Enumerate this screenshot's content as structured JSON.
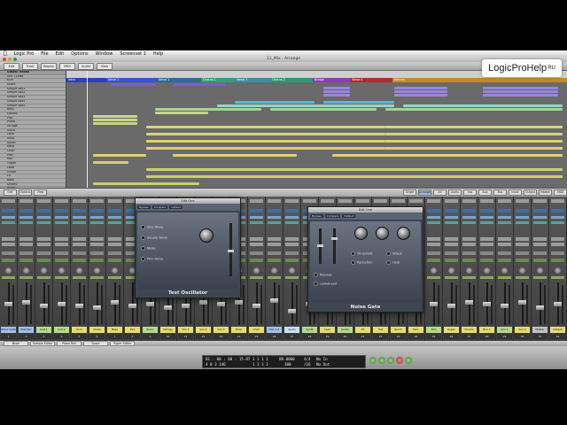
{
  "menubar": {
    "apple": "",
    "items": [
      "Logic Pro",
      "File",
      "Edit",
      "Options",
      "Window",
      "Screenset 1",
      "Help"
    ]
  },
  "window": {
    "title": "11_Mix - Arrange"
  },
  "toolbar": {
    "buttons": [
      "Edit",
      "Track",
      "Region",
      "MIDI",
      "Audio",
      "View"
    ]
  },
  "arrange": {
    "tracklist_header": "Global Tracks",
    "tracks": [
      "Inst 1 Lead",
      "Kick",
      "Snare",
      "Simple Vox1",
      "Simple Vox2",
      "Simple Vox3",
      "Simple Vox4",
      "Simple Vox5",
      "Bass",
      "Electric",
      "Pad",
      "Piano",
      "Strings",
      "Violin",
      "Cello",
      "Viola",
      "Synth",
      "Harp",
      "Choir",
      "Perc",
      "Hat",
      "Organ",
      "Lead",
      "Guitar",
      "FX",
      "Bass",
      "Drums",
      "Room",
      "Shaker",
      "Tom",
      "Vox"
    ],
    "markers": [
      {
        "label": "Intro",
        "color": "#2f3fbf"
      },
      {
        "label": "Verse 1",
        "color": "#3a52d1"
      },
      {
        "label": "Verse 2",
        "color": "#2f6a9a"
      },
      {
        "label": "Chorus 1",
        "color": "#2fa07a"
      },
      {
        "label": "Verse 3",
        "color": "#3a8fa6"
      },
      {
        "label": "Chorus 2",
        "color": "#2b9b6f"
      },
      {
        "label": "Bridge",
        "color": "#8a3fb0"
      },
      {
        "label": "Verse 4",
        "color": "#b02d2d"
      },
      {
        "label": "Refrain",
        "color": "#c48a2a"
      }
    ]
  },
  "mixer": {
    "tabs": [
      "Edit",
      "Options",
      "View",
      "Single",
      "Arrange",
      "All",
      "Audio",
      "Inst",
      "Aux",
      "Bus",
      "Input",
      "Output",
      "Master",
      "MIDI"
    ],
    "strips": [
      {
        "name": "Noise Gate",
        "num": "1"
      },
      {
        "name": "Test Osc",
        "num": "2"
      },
      {
        "name": "Inst 1",
        "num": "3"
      },
      {
        "name": "Inst 2",
        "num": "4"
      },
      {
        "name": "Kick",
        "num": "5"
      },
      {
        "name": "Snare",
        "num": "6"
      },
      {
        "name": "Bass",
        "num": "7"
      },
      {
        "name": "Pad",
        "num": "8"
      },
      {
        "name": "Piano",
        "num": "9"
      },
      {
        "name": "Strings",
        "num": "10"
      },
      {
        "name": "Vox 1",
        "num": "11"
      },
      {
        "name": "Vox 2",
        "num": "12"
      },
      {
        "name": "Vox 3",
        "num": "13"
      },
      {
        "name": "Harp",
        "num": "14"
      },
      {
        "name": "Choir",
        "num": "15"
      },
      {
        "name": "Out 1-2",
        "num": "16"
      },
      {
        "name": "Audio",
        "num": "17"
      },
      {
        "name": "Synth",
        "num": "18"
      },
      {
        "name": "Lead",
        "num": "19"
      },
      {
        "name": "Guitar",
        "num": "20"
      },
      {
        "name": "FX",
        "num": "21"
      },
      {
        "name": "Hat",
        "num": "22"
      },
      {
        "name": "Room",
        "num": "23"
      },
      {
        "name": "Perc",
        "num": "24"
      },
      {
        "name": "Tom",
        "num": "25"
      },
      {
        "name": "Organ",
        "num": "26"
      },
      {
        "name": "Drums",
        "num": "27"
      },
      {
        "name": "Bus 1",
        "num": "28"
      },
      {
        "name": "Aux 1",
        "num": "29"
      },
      {
        "name": "Aux 2",
        "num": "30"
      },
      {
        "name": "Master",
        "num": "31"
      },
      {
        "name": "Output",
        "num": "32"
      }
    ]
  },
  "plugins": {
    "test_oscillator": {
      "window_title": "Edit One",
      "bar": [
        "Bypass",
        "Compare",
        "Default"
      ],
      "name": "Test Oscillator",
      "options": [
        "Sine Wave",
        "Square Wave",
        "Noise",
        "Pink Noise"
      ]
    },
    "noise_gate": {
      "window_title": "Edit One",
      "bar": [
        "Bypass",
        "Compare",
        "Default"
      ],
      "name": "Noise Gate",
      "labels": [
        "Threshold",
        "Reduction",
        "Attack",
        "Hold",
        "Release",
        "Lookahead"
      ]
    }
  },
  "bottombar": {
    "tabs": [
      "Mixer",
      "Sample Editor",
      "Piano Roll",
      "Score",
      "Hyper Editor"
    ]
  },
  "transport": {
    "position_top": "01 : 00 : 00 : 15.87",
    "position_bottom": "4 0 3 146",
    "bars_top": "1 1 1 1",
    "bars_bottom": "1 1 1 1",
    "tempo": "88.0000",
    "tempo_sub": "100",
    "signature": "4/4",
    "division": "/16",
    "in": "No In",
    "out": "No Out"
  },
  "watermark": {
    "text": "LogicProHelp",
    "suffix": "RU"
  }
}
